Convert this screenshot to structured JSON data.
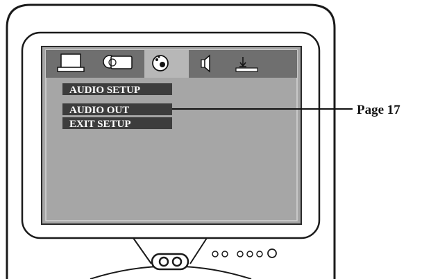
{
  "osd": {
    "tabs": [
      {
        "id": "system",
        "icon": "monitor-tab-icon"
      },
      {
        "id": "video",
        "icon": "video-tab-icon"
      },
      {
        "id": "audio",
        "icon": "audio-disc-tab-icon",
        "active": true
      },
      {
        "id": "speaker",
        "icon": "speaker-tab-icon"
      },
      {
        "id": "preference",
        "icon": "download-tab-icon"
      }
    ],
    "menu": {
      "title": "AUDIO SETUP",
      "items": [
        {
          "label": "AUDIO OUT",
          "selected": true
        },
        {
          "label": "EXIT SETUP"
        }
      ]
    }
  },
  "callout": {
    "label": "Page 17"
  },
  "colors": {
    "screen": "#a6a6a6",
    "tab_bar": "#6f6f6f",
    "tab_active": "#b7b7b7",
    "menu_bar": "#3d3d3d",
    "outline": "#1a1a1a"
  }
}
